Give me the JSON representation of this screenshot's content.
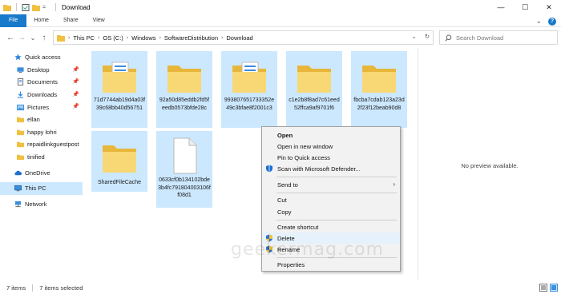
{
  "window": {
    "title": "Download",
    "minimize": "—",
    "maximize": "☐",
    "close": "✕"
  },
  "ribbon": {
    "tabs": [
      "File",
      "Home",
      "Share",
      "View"
    ],
    "expand_icon": "⌄",
    "help_icon": "?"
  },
  "nav_buttons": {
    "back": "←",
    "forward": "→",
    "recent": "⌄",
    "up": "↑"
  },
  "address": {
    "crumbs": [
      "This PC",
      "OS (C:)",
      "Windows",
      "SoftwareDistribution",
      "Download"
    ],
    "separator": "›",
    "dropdown": "⌄",
    "refresh": "↻"
  },
  "search": {
    "placeholder": "Search Download"
  },
  "sidebar": {
    "items": [
      {
        "label": "Quick access",
        "icon": "star-icon",
        "pinned": false
      },
      {
        "label": "Desktop",
        "icon": "desktop-icon",
        "pinned": true
      },
      {
        "label": "Documents",
        "icon": "documents-icon",
        "pinned": true
      },
      {
        "label": "Downloads",
        "icon": "download-icon",
        "pinned": true
      },
      {
        "label": "Pictures",
        "icon": "pictures-icon",
        "pinned": true
      },
      {
        "label": "ellan",
        "icon": "folder-icon",
        "pinned": false
      },
      {
        "label": "happy lohri",
        "icon": "folder-icon",
        "pinned": false
      },
      {
        "label": "repaidlinkguestpost",
        "icon": "folder-icon",
        "pinned": false
      },
      {
        "label": "tinified",
        "icon": "folder-icon",
        "pinned": false
      },
      {
        "label": "OneDrive",
        "icon": "cloud-icon",
        "pinned": false
      },
      {
        "label": "This PC",
        "icon": "computer-icon",
        "pinned": false
      },
      {
        "label": "Network",
        "icon": "network-icon",
        "pinned": false
      }
    ]
  },
  "files": [
    {
      "name": "71d7744ab19d4a03f39c68bb40d56751",
      "type": "folder-docs"
    },
    {
      "name": "92a50d85eddb2fd5feedb0573bfde28c",
      "type": "folder"
    },
    {
      "name": "993807651733352e49c3bfae8f2001c3",
      "type": "folder-docs"
    },
    {
      "name": "c1e2b8f8ad7c61eed52ffca9af9701f6",
      "type": "folder"
    },
    {
      "name": "fbcba7cdab123a23d2f23f12beab90d8",
      "type": "folder"
    },
    {
      "name": "SharedFileCache",
      "type": "folder"
    },
    {
      "name": "0633cf0b134102bde3b4fc791804003106ff08d1",
      "type": "file"
    }
  ],
  "preview": {
    "text": "No preview available."
  },
  "context_menu": {
    "items": [
      {
        "label": "Open",
        "bold": true
      },
      {
        "label": "Open in new window"
      },
      {
        "label": "Pin to Quick access"
      },
      {
        "label": "Scan with Microsoft Defender...",
        "icon": "defender-icon"
      },
      {
        "label": "Send to",
        "submenu": true
      },
      {
        "label": "Cut"
      },
      {
        "label": "Copy"
      },
      {
        "label": "Create shortcut"
      },
      {
        "label": "Delete",
        "icon": "shield-icon",
        "hover": true
      },
      {
        "label": "Rename",
        "icon": "shield-icon"
      },
      {
        "label": "Properties"
      }
    ],
    "submenu_arrow": "›"
  },
  "status": {
    "count": "7 items",
    "selected": "7 items selected"
  },
  "watermark": "geekermag.com",
  "colors": {
    "accent": "#1979ca",
    "selection": "#cce8ff",
    "folder": "#f8d775"
  }
}
